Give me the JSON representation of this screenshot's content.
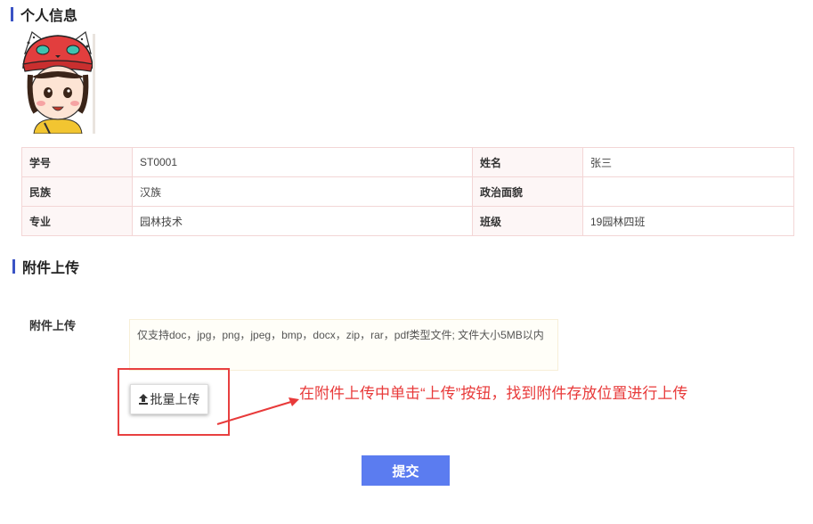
{
  "sections": {
    "personal_title": "个人信息",
    "attach_title": "附件上传"
  },
  "info_table": {
    "rows": [
      {
        "label1": "学号",
        "value1": "ST0001",
        "label2": "姓名",
        "value2": "张三"
      },
      {
        "label1": "民族",
        "value1": "汉族",
        "label2": "政治面貌",
        "value2": ""
      },
      {
        "label1": "专业",
        "value1": "园林技术",
        "label2": "班级",
        "value2": "19园林四班"
      }
    ]
  },
  "upload": {
    "label": "附件上传",
    "hint": "仅支持doc，jpg，png，jpeg，bmp，docx，zip，rar，pdf类型文件; 文件大小5MB以内",
    "batch_button": "批量上传",
    "upload_icon": "upload-arrow-icon"
  },
  "annotation": {
    "text": "在附件上传中单击“上传”按钮，找到附件存放位置进行上传",
    "color": "#e83a3a"
  },
  "submit": {
    "label": "提交",
    "color": "#5b7cf0"
  },
  "colors": {
    "accent_bar": "#3a53c5",
    "table_border": "#f3d6d6",
    "label_bg": "#fdf6f6"
  }
}
